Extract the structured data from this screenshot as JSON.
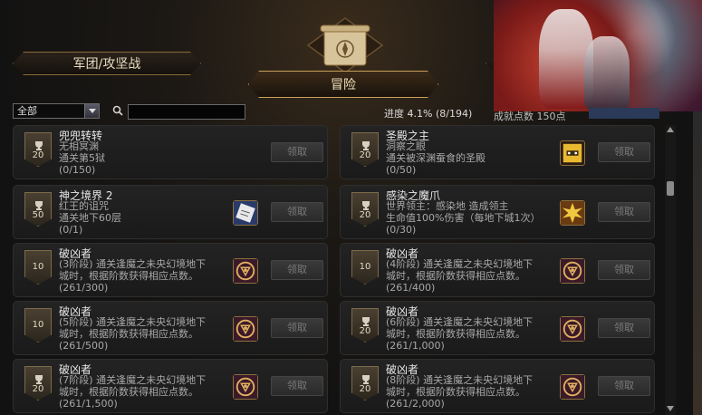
{
  "tabs": {
    "left_label": "军团/攻坚战",
    "main_label": "冒险"
  },
  "filter": {
    "selected": "全部",
    "search_placeholder": ""
  },
  "progress": {
    "label": "进度",
    "percent": "4.1%",
    "count": "(8/194)"
  },
  "partial_text": "成就点数 150点",
  "claim_label": "领取",
  "achievements": [
    {
      "title": "兜兜转转",
      "lines": [
        "无相冥渊",
        "通关第5狱",
        "(0/150)"
      ],
      "points": "20",
      "cup": true,
      "reward_icon": ""
    },
    {
      "title": "圣殿之主",
      "lines": [
        "洞察之眼",
        "通关被深渊蚕食的圣殿",
        "(0/50)"
      ],
      "points": "20",
      "cup": true,
      "reward_icon": "dice-icon"
    },
    {
      "title": "神之境界 2",
      "lines": [
        "红王的诅咒",
        "通关地下60层",
        "(0/1)"
      ],
      "points": "50",
      "cup": true,
      "reward_icon": "scroll-icon"
    },
    {
      "title": "感染之魔爪",
      "lines": [
        "世界领主：感染地        造成领主",
        "生命值100%伤害（每地下城1次）",
        "(0/30)"
      ],
      "points": "20",
      "cup": true,
      "reward_icon": "burst-icon"
    },
    {
      "title": "破凶者",
      "lines": [
        "(3阶段) 通关逢魔之未央幻境地下",
        "城时，根据阶数获得相应点数。",
        "(261/300)"
      ],
      "points": "10",
      "cup": false,
      "reward_icon": "emblem-icon"
    },
    {
      "title": "破凶者",
      "lines": [
        "(4阶段) 通关逢魔之未央幻境地下",
        "城时，根据阶数获得相应点数。",
        "(261/400)"
      ],
      "points": "10",
      "cup": false,
      "reward_icon": "emblem-icon"
    },
    {
      "title": "破凶者",
      "lines": [
        "(5阶段) 通关逢魔之未央幻境地下",
        "城时，根据阶数获得相应点数。",
        "(261/500)"
      ],
      "points": "10",
      "cup": false,
      "reward_icon": "emblem-icon"
    },
    {
      "title": "破凶者",
      "lines": [
        "(6阶段) 通关逢魔之未央幻境地下",
        "城时，根据阶数获得相应点数。",
        "(261/1,000)"
      ],
      "points": "20",
      "cup": true,
      "reward_icon": "emblem-icon"
    },
    {
      "title": "破凶者",
      "lines": [
        "(7阶段) 通关逢魔之未央幻境地下",
        "城时，根据阶数获得相应点数。",
        "(261/1,500)"
      ],
      "points": "20",
      "cup": true,
      "reward_icon": "emblem-icon"
    },
    {
      "title": "破凶者",
      "lines": [
        "(8阶段) 通关逢魔之未央幻境地下",
        "城时，根据阶数获得相应点数。",
        "(261/2,000)"
      ],
      "points": "20",
      "cup": true,
      "reward_icon": "emblem-icon"
    }
  ]
}
